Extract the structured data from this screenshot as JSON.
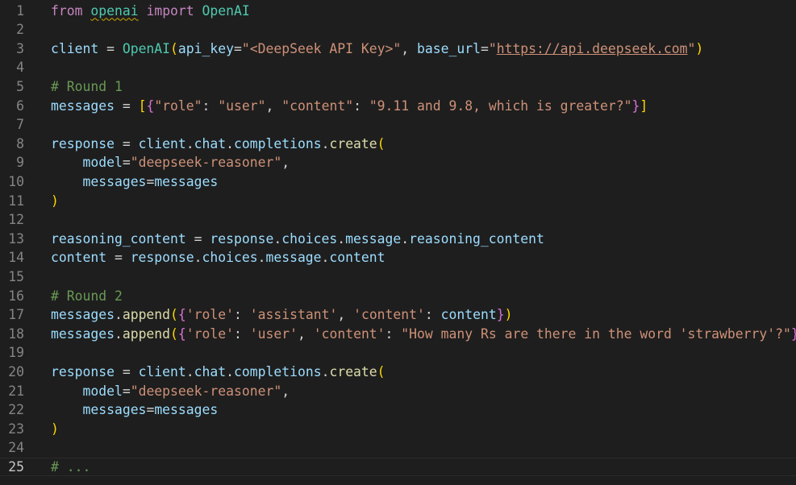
{
  "editor": {
    "active_line": "25",
    "lines": [
      {
        "n": "1",
        "tokens": [
          [
            "kw",
            "from"
          ],
          [
            "plain",
            " "
          ],
          [
            "cls-sq",
            "openai"
          ],
          [
            "plain",
            " "
          ],
          [
            "kw",
            "import"
          ],
          [
            "plain",
            " "
          ],
          [
            "cls",
            "OpenAI"
          ]
        ]
      },
      {
        "n": "2",
        "tokens": []
      },
      {
        "n": "3",
        "tokens": [
          [
            "var",
            "client"
          ],
          [
            "plain",
            " = "
          ],
          [
            "cls",
            "OpenAI"
          ],
          [
            "b1",
            "("
          ],
          [
            "var",
            "api_key"
          ],
          [
            "plain",
            "="
          ],
          [
            "str",
            "\"<DeepSeek API Key>\""
          ],
          [
            "plain",
            ", "
          ],
          [
            "var",
            "base_url"
          ],
          [
            "plain",
            "="
          ],
          [
            "str",
            "\""
          ],
          [
            "str-link",
            "https://api.deepseek.com"
          ],
          [
            "str",
            "\""
          ],
          [
            "b1",
            ")"
          ]
        ]
      },
      {
        "n": "4",
        "tokens": []
      },
      {
        "n": "5",
        "tokens": [
          [
            "cmt",
            "# Round 1"
          ]
        ]
      },
      {
        "n": "6",
        "tokens": [
          [
            "var",
            "messages"
          ],
          [
            "plain",
            " = "
          ],
          [
            "b1",
            "["
          ],
          [
            "b2",
            "{"
          ],
          [
            "str",
            "\"role\""
          ],
          [
            "plain",
            ": "
          ],
          [
            "str",
            "\"user\""
          ],
          [
            "plain",
            ", "
          ],
          [
            "str",
            "\"content\""
          ],
          [
            "plain",
            ": "
          ],
          [
            "str",
            "\"9.11 and 9.8, which is greater?\""
          ],
          [
            "b2",
            "}"
          ],
          [
            "b1",
            "]"
          ]
        ]
      },
      {
        "n": "7",
        "tokens": []
      },
      {
        "n": "8",
        "tokens": [
          [
            "var",
            "response"
          ],
          [
            "plain",
            " = "
          ],
          [
            "var",
            "client"
          ],
          [
            "plain",
            "."
          ],
          [
            "var",
            "chat"
          ],
          [
            "plain",
            "."
          ],
          [
            "var",
            "completions"
          ],
          [
            "plain",
            "."
          ],
          [
            "fn",
            "create"
          ],
          [
            "b1",
            "("
          ]
        ]
      },
      {
        "n": "9",
        "tokens": [
          [
            "plain",
            "    "
          ],
          [
            "var",
            "model"
          ],
          [
            "plain",
            "="
          ],
          [
            "str",
            "\"deepseek-reasoner\""
          ],
          [
            "plain",
            ","
          ]
        ]
      },
      {
        "n": "10",
        "tokens": [
          [
            "plain",
            "    "
          ],
          [
            "var",
            "messages"
          ],
          [
            "plain",
            "="
          ],
          [
            "var",
            "messages"
          ]
        ]
      },
      {
        "n": "11",
        "tokens": [
          [
            "b1",
            ")"
          ]
        ]
      },
      {
        "n": "12",
        "tokens": []
      },
      {
        "n": "13",
        "tokens": [
          [
            "var",
            "reasoning_content"
          ],
          [
            "plain",
            " = "
          ],
          [
            "var",
            "response"
          ],
          [
            "plain",
            "."
          ],
          [
            "var",
            "choices"
          ],
          [
            "plain",
            "."
          ],
          [
            "var",
            "message"
          ],
          [
            "plain",
            "."
          ],
          [
            "var",
            "reasoning_content"
          ]
        ]
      },
      {
        "n": "14",
        "tokens": [
          [
            "var",
            "content"
          ],
          [
            "plain",
            " = "
          ],
          [
            "var",
            "response"
          ],
          [
            "plain",
            "."
          ],
          [
            "var",
            "choices"
          ],
          [
            "plain",
            "."
          ],
          [
            "var",
            "message"
          ],
          [
            "plain",
            "."
          ],
          [
            "var",
            "content"
          ]
        ]
      },
      {
        "n": "15",
        "tokens": []
      },
      {
        "n": "16",
        "tokens": [
          [
            "cmt",
            "# Round 2"
          ]
        ]
      },
      {
        "n": "17",
        "tokens": [
          [
            "var",
            "messages"
          ],
          [
            "plain",
            "."
          ],
          [
            "fn",
            "append"
          ],
          [
            "b1",
            "("
          ],
          [
            "b2",
            "{"
          ],
          [
            "str",
            "'role'"
          ],
          [
            "plain",
            ": "
          ],
          [
            "str",
            "'assistant'"
          ],
          [
            "plain",
            ", "
          ],
          [
            "str",
            "'content'"
          ],
          [
            "plain",
            ": "
          ],
          [
            "var",
            "content"
          ],
          [
            "b2",
            "}"
          ],
          [
            "b1",
            ")"
          ]
        ]
      },
      {
        "n": "18",
        "tokens": [
          [
            "var",
            "messages"
          ],
          [
            "plain",
            "."
          ],
          [
            "fn",
            "append"
          ],
          [
            "b1",
            "("
          ],
          [
            "b2",
            "{"
          ],
          [
            "str",
            "'role'"
          ],
          [
            "plain",
            ": "
          ],
          [
            "str",
            "'user'"
          ],
          [
            "plain",
            ", "
          ],
          [
            "str",
            "'content'"
          ],
          [
            "plain",
            ": "
          ],
          [
            "str",
            "\"How many Rs are there in the word 'strawberry'?\""
          ],
          [
            "b2",
            "}"
          ],
          [
            "b1",
            ")"
          ]
        ]
      },
      {
        "n": "19",
        "tokens": []
      },
      {
        "n": "20",
        "tokens": [
          [
            "var",
            "response"
          ],
          [
            "plain",
            " = "
          ],
          [
            "var",
            "client"
          ],
          [
            "plain",
            "."
          ],
          [
            "var",
            "chat"
          ],
          [
            "plain",
            "."
          ],
          [
            "var",
            "completions"
          ],
          [
            "plain",
            "."
          ],
          [
            "fn",
            "create"
          ],
          [
            "b1",
            "("
          ]
        ]
      },
      {
        "n": "21",
        "tokens": [
          [
            "plain",
            "    "
          ],
          [
            "var",
            "model"
          ],
          [
            "plain",
            "="
          ],
          [
            "str",
            "\"deepseek-reasoner\""
          ],
          [
            "plain",
            ","
          ]
        ]
      },
      {
        "n": "22",
        "tokens": [
          [
            "plain",
            "    "
          ],
          [
            "var",
            "messages"
          ],
          [
            "plain",
            "="
          ],
          [
            "var",
            "messages"
          ]
        ]
      },
      {
        "n": "23",
        "tokens": [
          [
            "b1",
            ")"
          ]
        ]
      },
      {
        "n": "24",
        "tokens": []
      },
      {
        "n": "25",
        "tokens": [
          [
            "cmt",
            "# ..."
          ]
        ]
      }
    ]
  },
  "colors": {
    "background": "#1e1e1e",
    "keyword": "#c586c0",
    "variable": "#9cdcfe",
    "class": "#4ec9b0",
    "function": "#dcdcaa",
    "string": "#ce9178",
    "comment": "#6a9955",
    "bracket_level_1": "#ffd700",
    "bracket_level_2": "#da70d6",
    "line_number": "#858585"
  }
}
